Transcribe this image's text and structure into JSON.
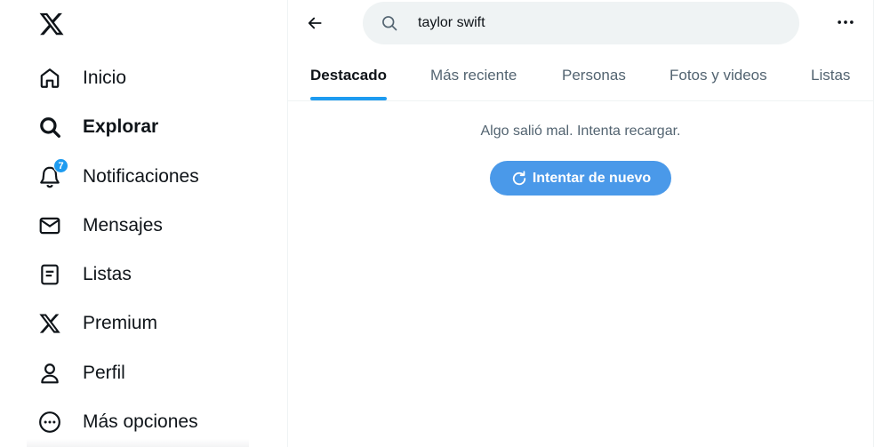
{
  "sidebar": {
    "logo_icon": "x-logo-icon",
    "items": [
      {
        "label": "Inicio",
        "icon": "home-icon",
        "bold": false
      },
      {
        "label": "Explorar",
        "icon": "search-icon",
        "bold": true
      },
      {
        "label": "Notificaciones",
        "icon": "bell-icon",
        "bold": false,
        "badge": "7"
      },
      {
        "label": "Mensajes",
        "icon": "envelope-icon",
        "bold": false
      },
      {
        "label": "Listas",
        "icon": "list-icon",
        "bold": false
      },
      {
        "label": "Premium",
        "icon": "x-logo-icon",
        "bold": false
      },
      {
        "label": "Perfil",
        "icon": "person-icon",
        "bold": false
      },
      {
        "label": "Más opciones",
        "icon": "more-circle-icon",
        "bold": false
      }
    ]
  },
  "header": {
    "search_value": "taylor swift",
    "back_icon": "arrow-left-icon",
    "more_icon": "ellipsis-icon"
  },
  "tabs": [
    {
      "label": "Destacado",
      "active": true
    },
    {
      "label": "Más reciente",
      "active": false
    },
    {
      "label": "Personas",
      "active": false
    },
    {
      "label": "Fotos y videos",
      "active": false
    },
    {
      "label": "Listas",
      "active": false
    }
  ],
  "content": {
    "error_message": "Algo salió mal. Intenta recargar.",
    "retry_label": "Intentar de nuevo"
  },
  "colors": {
    "accent": "#1d9bf0",
    "retry_button": "#4a99e9",
    "text_primary": "#0f1419",
    "text_secondary": "#536471",
    "search_bg": "#eff3f4"
  }
}
